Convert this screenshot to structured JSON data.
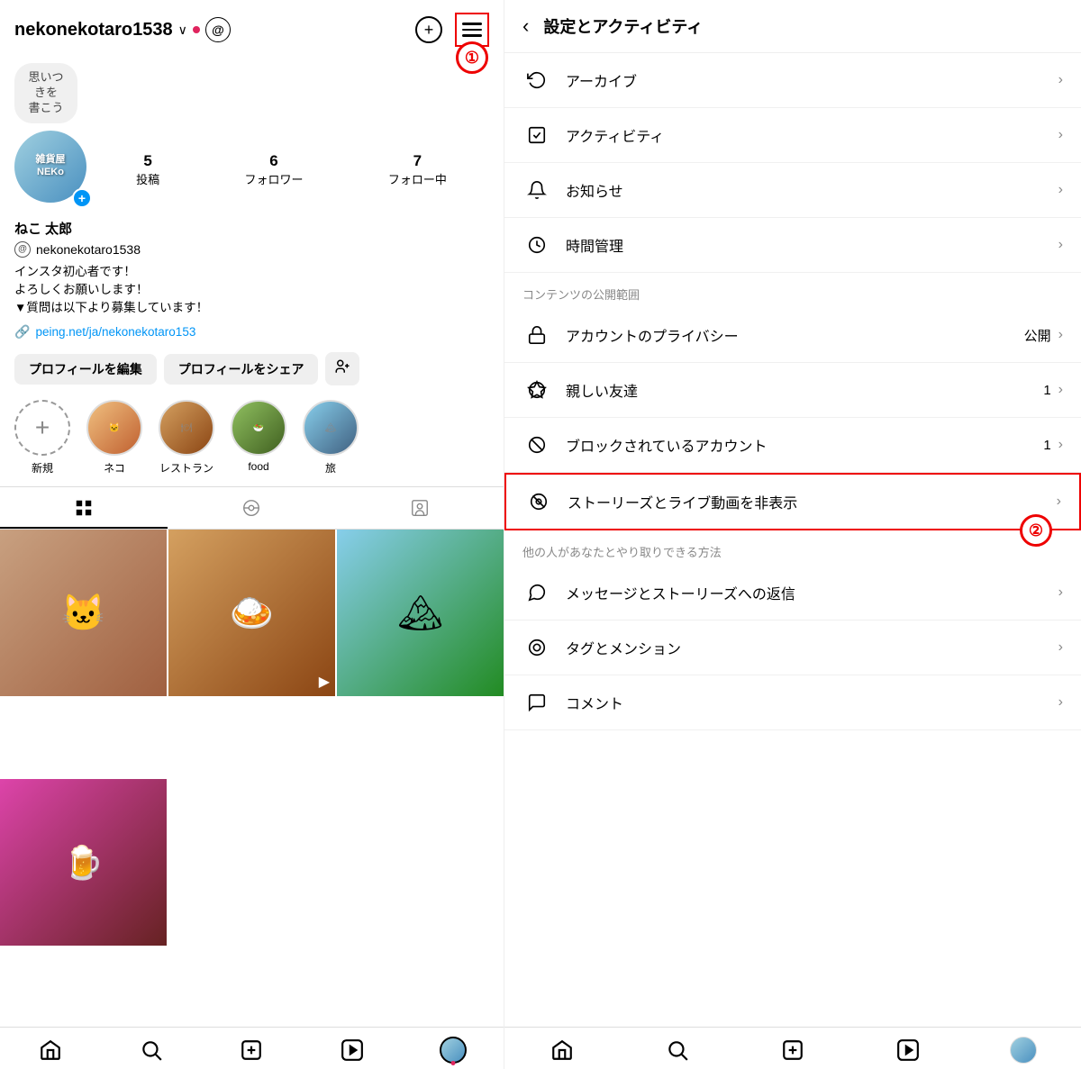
{
  "left": {
    "username": "nekonekotaro1538",
    "dropdown_icon": "∨",
    "threads_icon": "@",
    "idea_bubble": "思いつきを\n書こう",
    "stats": [
      {
        "num": "5",
        "label": "投稿"
      },
      {
        "num": "6",
        "label": "フォロワー"
      },
      {
        "num": "7",
        "label": "フォロー中"
      }
    ],
    "name": "ねこ 太郎",
    "handle": "nekonekotaro1538",
    "bio_lines": [
      "インスタ初心者です！",
      "よろしくお願いします！",
      "▼質問は以下より募集しています！"
    ],
    "link": "peing.net/ja/nekonekotaro153",
    "buttons": {
      "edit": "プロフィールを編集",
      "share": "プロフィールをシェア",
      "add_friend": "+"
    },
    "highlights": [
      {
        "label": "新規",
        "type": "new"
      },
      {
        "label": "ネコ",
        "type": "cat"
      },
      {
        "label": "レストラン",
        "type": "restaurant"
      },
      {
        "label": "food",
        "type": "food"
      },
      {
        "label": "旅",
        "type": "travel"
      }
    ],
    "tabs": [
      "grid",
      "video",
      "person"
    ],
    "annotation1": "①",
    "annotation_menu_label": "≡"
  },
  "right": {
    "back_icon": "‹",
    "title": "設定とアクティビティ",
    "menu_items": [
      {
        "icon": "↺",
        "label": "アーカイブ",
        "badge": "",
        "chevron": "›",
        "highlighted": false
      },
      {
        "icon": "📊",
        "label": "アクティビティ",
        "badge": "",
        "chevron": "›",
        "highlighted": false
      },
      {
        "icon": "🔔",
        "label": "お知らせ",
        "badge": "",
        "chevron": "›",
        "highlighted": false
      },
      {
        "icon": "⏱",
        "label": "時間管理",
        "badge": "",
        "chevron": "›",
        "highlighted": false
      }
    ],
    "section_label1": "コンテンツの公開範囲",
    "privacy_items": [
      {
        "icon": "🔒",
        "label": "アカウントのプライバシー",
        "badge": "公開",
        "chevron": "›",
        "highlighted": false
      },
      {
        "icon": "⭐",
        "label": "親しい友達",
        "badge": "1",
        "chevron": "›",
        "highlighted": false
      },
      {
        "icon": "🚫",
        "label": "ブロックされているアカウント",
        "badge": "1",
        "chevron": "›",
        "highlighted": false
      },
      {
        "icon": "👁",
        "label": "ストーリーズとライブ動画を非表示",
        "badge": "",
        "chevron": "›",
        "highlighted": true
      }
    ],
    "section_label2": "他の人があなたとやり取りできる方法",
    "interaction_items": [
      {
        "icon": "💬",
        "label": "メッセージとストーリーズへの返信",
        "badge": "",
        "chevron": "›",
        "highlighted": false
      },
      {
        "icon": "@",
        "label": "タグとメンション",
        "badge": "",
        "chevron": "›",
        "highlighted": false
      },
      {
        "icon": "🗨",
        "label": "コメント",
        "badge": "",
        "chevron": "›",
        "highlighted": false
      }
    ],
    "annotation2": "②"
  },
  "icons": {
    "home": "⌂",
    "search": "🔍",
    "add": "⊕",
    "reels": "▶",
    "profile": "👤",
    "menu_bars": "≡",
    "back_chevron": "<"
  }
}
